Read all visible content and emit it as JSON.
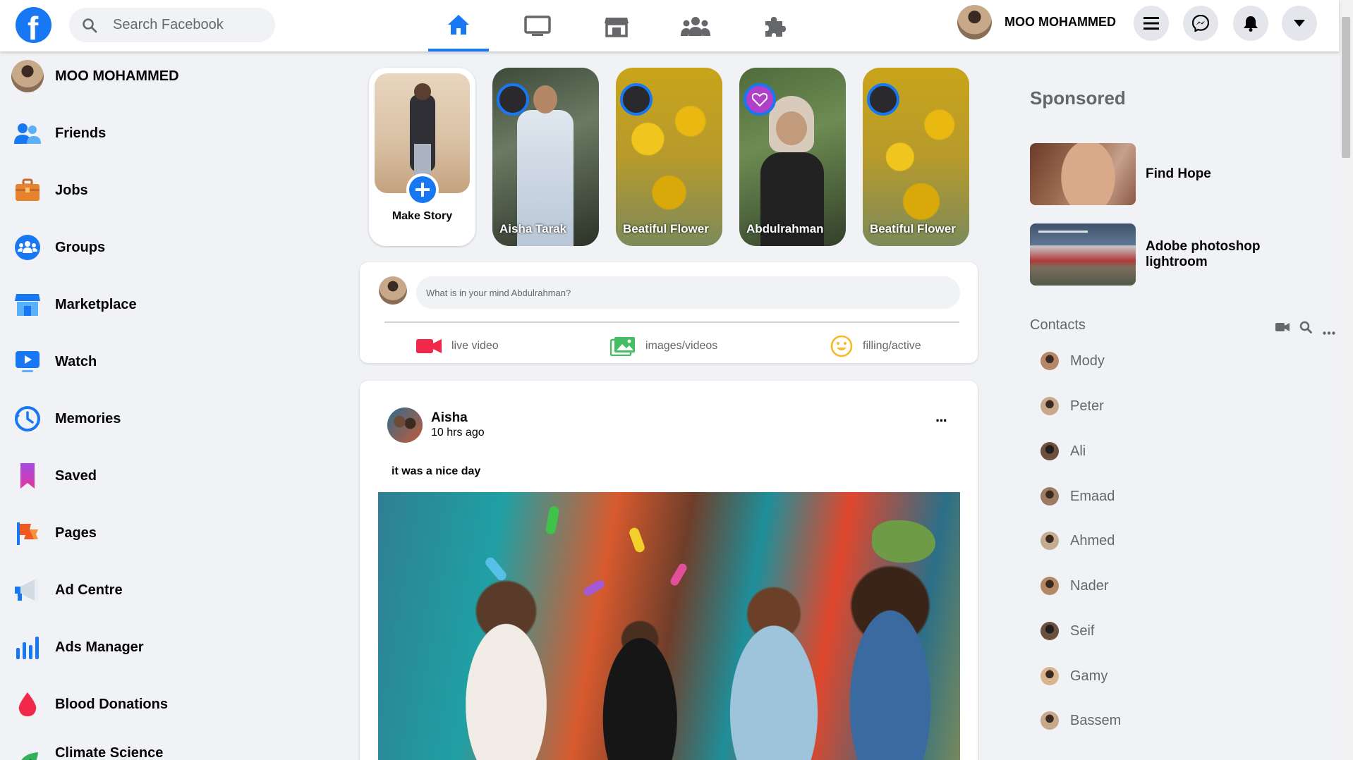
{
  "header": {
    "logo": "f",
    "search_placeholder": "Search Facebook",
    "nav_tabs": [
      "home-icon",
      "watch-icon",
      "marketplace-icon",
      "groups-icon",
      "gaming-icon"
    ],
    "active_tab": "home-icon",
    "user_name": "MOO MOHAMMED",
    "buttons": [
      "menu-icon",
      "messenger-icon",
      "bell-icon",
      "caret-down-icon"
    ]
  },
  "sidebar": {
    "profile_name": "MOO MOHAMMED",
    "items": [
      {
        "label": "Friends",
        "icon": "friends-icon"
      },
      {
        "label": "Jobs",
        "icon": "briefcase-icon"
      },
      {
        "label": "Groups",
        "icon": "groups-icon"
      },
      {
        "label": "Marketplace",
        "icon": "shop-icon"
      },
      {
        "label": "Watch",
        "icon": "watch-icon"
      },
      {
        "label": "Memories",
        "icon": "clock-icon"
      },
      {
        "label": "Saved",
        "icon": "bookmark-icon"
      },
      {
        "label": "Pages",
        "icon": "flag-icon"
      },
      {
        "label": "Ad Centre",
        "icon": "megaphone-icon"
      },
      {
        "label": "Ads Manager",
        "icon": "bar-chart-icon"
      },
      {
        "label": "Blood Donations",
        "icon": "drop-icon"
      },
      {
        "label": "Climate Science Centre",
        "icon": "leaf-icon"
      }
    ]
  },
  "stories": {
    "make_story": "Make Story",
    "items": [
      {
        "title": "Aisha Tarak"
      },
      {
        "title": "Beatiful Flower"
      },
      {
        "title": "Abdulrahman"
      },
      {
        "title": "Beatiful Flower"
      }
    ]
  },
  "composer": {
    "placeholder": "What is in your mind Abdulrahman?",
    "actions": [
      "live video",
      "images/videos",
      "filling/active"
    ]
  },
  "post": {
    "author": "Aisha",
    "time": "10 hrs ago",
    "text": "it was a nice day",
    "more": "···"
  },
  "sponsored": {
    "title": "Sponsored",
    "ads": [
      {
        "title": "Find Hope"
      },
      {
        "title": "Adobe photoshop lightroom"
      }
    ]
  },
  "contacts": {
    "title": "Contacts",
    "people": [
      "Mody",
      "Peter",
      "Ali",
      "Emaad",
      "Ahmed",
      "Nader",
      "Seif",
      "Gamy",
      "Bassem"
    ]
  },
  "colors": {
    "brand": "#1877f2",
    "background": "#f0f2f5",
    "text_secondary": "#65676b"
  }
}
